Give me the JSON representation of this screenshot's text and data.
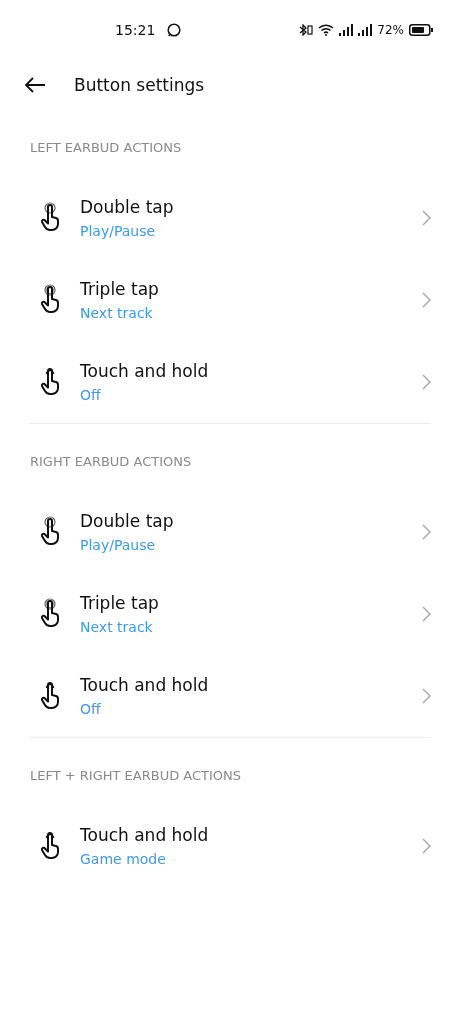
{
  "status_bar": {
    "time": "15:21",
    "battery": "72%"
  },
  "header": {
    "title": "Button settings"
  },
  "sections": [
    {
      "title": "LEFT EARBUD ACTIONS",
      "items": [
        {
          "kind": "double",
          "title": "Double tap",
          "value": "Play/Pause"
        },
        {
          "kind": "triple",
          "title": "Triple tap",
          "value": "Next track"
        },
        {
          "kind": "hold",
          "title": "Touch and hold",
          "value": "Off"
        }
      ]
    },
    {
      "title": "RIGHT EARBUD ACTIONS",
      "items": [
        {
          "kind": "double",
          "title": "Double tap",
          "value": "Play/Pause"
        },
        {
          "kind": "triple",
          "title": "Triple tap",
          "value": "Next track"
        },
        {
          "kind": "hold",
          "title": "Touch and hold",
          "value": "Off"
        }
      ]
    },
    {
      "title": "LEFT + RIGHT EARBUD ACTIONS",
      "items": [
        {
          "kind": "hold",
          "title": "Touch and hold",
          "value": "Game mode"
        }
      ]
    }
  ]
}
